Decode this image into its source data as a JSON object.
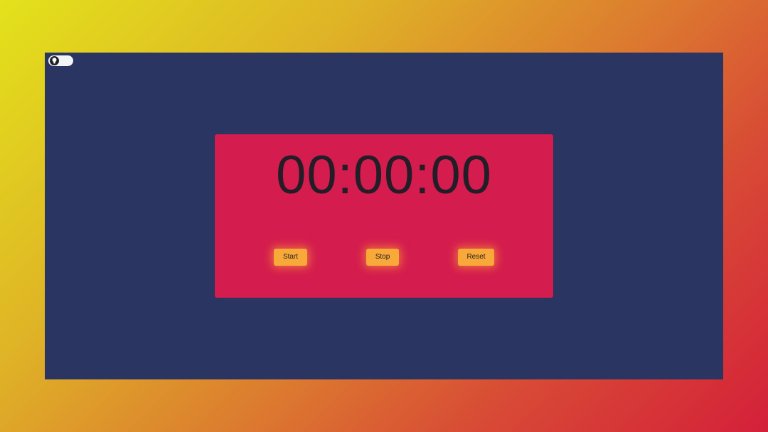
{
  "theme_toggle": {
    "icon": "bulb-icon"
  },
  "stopwatch": {
    "time": "00:00:00"
  },
  "controls": {
    "start_label": "Start",
    "stop_label": "Stop",
    "reset_label": "Reset"
  },
  "colors": {
    "frame_background": "#2a3562",
    "card_background": "#d41c4e",
    "button_background": "#f9a93a",
    "text_dark": "#231d27",
    "gradient_start": "#e3e21b",
    "gradient_end": "#d4203a"
  }
}
